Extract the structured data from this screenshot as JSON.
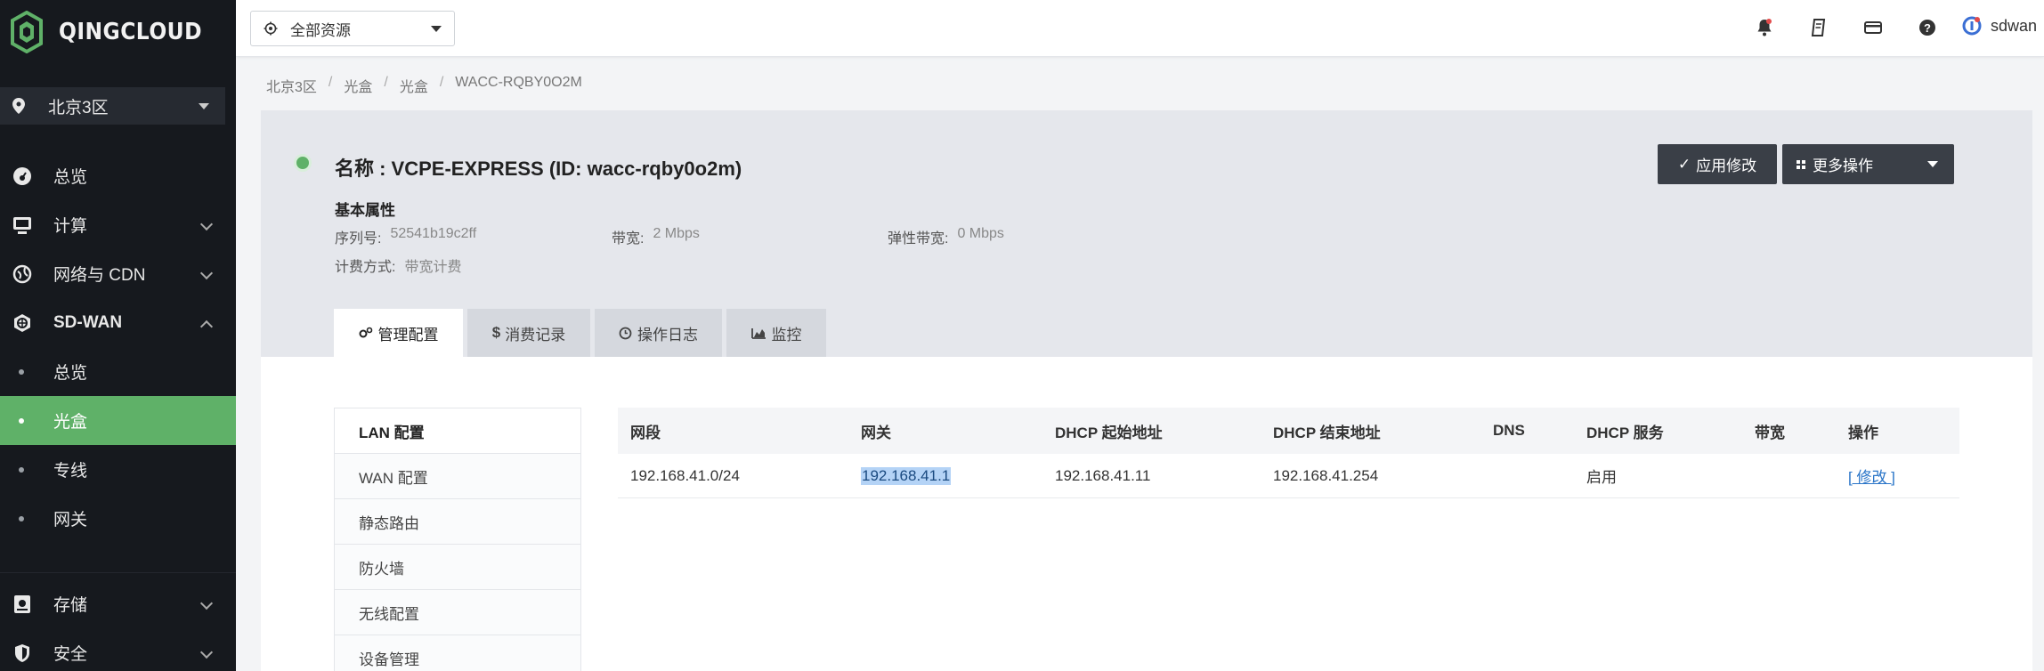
{
  "brand": {
    "name": "QINGCLOUD"
  },
  "sidebar": {
    "region": "北京3区",
    "items": [
      {
        "label": "总览",
        "icon": "dashboard-icon"
      },
      {
        "label": "计算",
        "icon": "monitor-icon"
      },
      {
        "label": "网络与 CDN",
        "icon": "network-icon"
      },
      {
        "label": "SD-WAN",
        "icon": "sdwan-icon"
      },
      {
        "label": "存储",
        "icon": "storage-icon"
      },
      {
        "label": "安全",
        "icon": "shield-icon"
      }
    ],
    "sdwan_sub": [
      "总览",
      "光盒",
      "专线",
      "网关"
    ],
    "active_sub": "光盒"
  },
  "topbar": {
    "resource_select": "全部资源",
    "icons": [
      "bell-icon",
      "ticket-icon",
      "billing-icon",
      "help-icon"
    ],
    "username": "sdwan"
  },
  "breadcrumb": [
    "北京3区",
    "光盒",
    "光盒",
    "WACC-RQBY0O2M"
  ],
  "header": {
    "title": "名称 : VCPE-EXPRESS (ID: wacc-rqby0o2m)",
    "section": "基本属性",
    "props": {
      "serial_key": "序列号:",
      "serial_val": "52541b19c2ff",
      "bandwidth_key": "带宽:",
      "bandwidth_val": "2 Mbps",
      "elastic_key": "弹性带宽:",
      "elastic_val": "0 Mbps",
      "billing_key": "计费方式:",
      "billing_val": "带宽计费"
    },
    "apply_button": "应用修改",
    "more_button": "更多操作",
    "tabs": [
      "管理配置",
      "消费记录",
      "操作日志",
      "监控"
    ]
  },
  "config_menu": [
    "LAN 配置",
    "WAN 配置",
    "静态路由",
    "防火墙",
    "无线配置",
    "设备管理"
  ],
  "table": {
    "columns": [
      "网段",
      "网关",
      "DHCP 起始地址",
      "DHCP 结束地址",
      "DNS",
      "DHCP 服务",
      "带宽",
      "操作"
    ],
    "rows": [
      [
        "192.168.41.0/24",
        "192.168.41.1",
        "192.168.41.11",
        "192.168.41.254",
        "",
        "启用",
        "",
        "[ 修改 ]"
      ]
    ]
  },
  "colors": {
    "sidebar_bg": "#16191e",
    "active_green": "#5fb168",
    "button_dark": "#3a3f47"
  }
}
